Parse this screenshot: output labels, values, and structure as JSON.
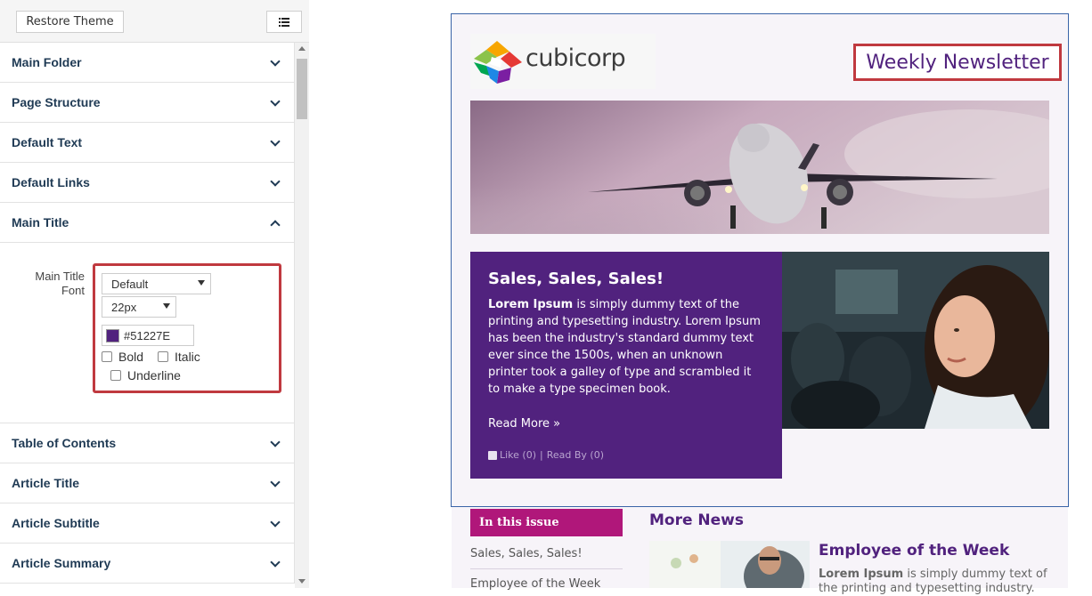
{
  "panel": {
    "restore_label": "Restore Theme",
    "list_icon": "list-icon",
    "sections_top": [
      {
        "label": "Main Folder",
        "icon": "chevron-down-icon"
      },
      {
        "label": "Page Structure",
        "icon": "chevron-down-icon"
      },
      {
        "label": "Default Text",
        "icon": "chevron-down-icon"
      },
      {
        "label": "Default Links",
        "icon": "chevron-down-icon"
      }
    ],
    "expanded": {
      "label": "Main Title",
      "icon": "chevron-up-icon",
      "field_label_line1": "Main Title",
      "field_label_line2": "Font",
      "font_family": "Default",
      "font_size": "22px",
      "color_value": "#51227E",
      "bold_label": "Bold",
      "italic_label": "Italic",
      "underline_label": "Underline",
      "bold_checked": false,
      "italic_checked": false,
      "underline_checked": false
    },
    "sections_bottom": [
      {
        "label": "Table of Contents",
        "icon": "chevron-down-icon"
      },
      {
        "label": "Article Title",
        "icon": "chevron-down-icon"
      },
      {
        "label": "Article Subtitle",
        "icon": "chevron-down-icon"
      },
      {
        "label": "Article Summary",
        "icon": "chevron-down-icon"
      }
    ]
  },
  "preview": {
    "logo_text": "cubicorp",
    "newsletter_title": "Weekly Newsletter",
    "article": {
      "title": "Sales, Sales, Sales!",
      "lead": "Lorem Ipsum",
      "body": " is simply dummy text of the printing and typesetting industry. Lorem Ipsum has been the industry's standard dummy text ever since the 1500s, when an unknown printer took a galley of type and scrambled it to make a type specimen book.",
      "read_more": "Read More »",
      "like": "Like (0)",
      "separator": "|",
      "read_by": "Read By (0)"
    },
    "toc": {
      "heading": "In this issue",
      "items": [
        "Sales, Sales, Sales!",
        "Employee of the Week"
      ]
    },
    "more_news": {
      "heading": "More News",
      "title": "Employee of the Week",
      "lead": "Lorem Ipsum",
      "body": " is simply dummy text of the printing and typesetting industry."
    }
  },
  "colors": {
    "brand_purple": "#51227E",
    "toc_magenta": "#B0177A",
    "highlight_red": "#C0393F"
  }
}
